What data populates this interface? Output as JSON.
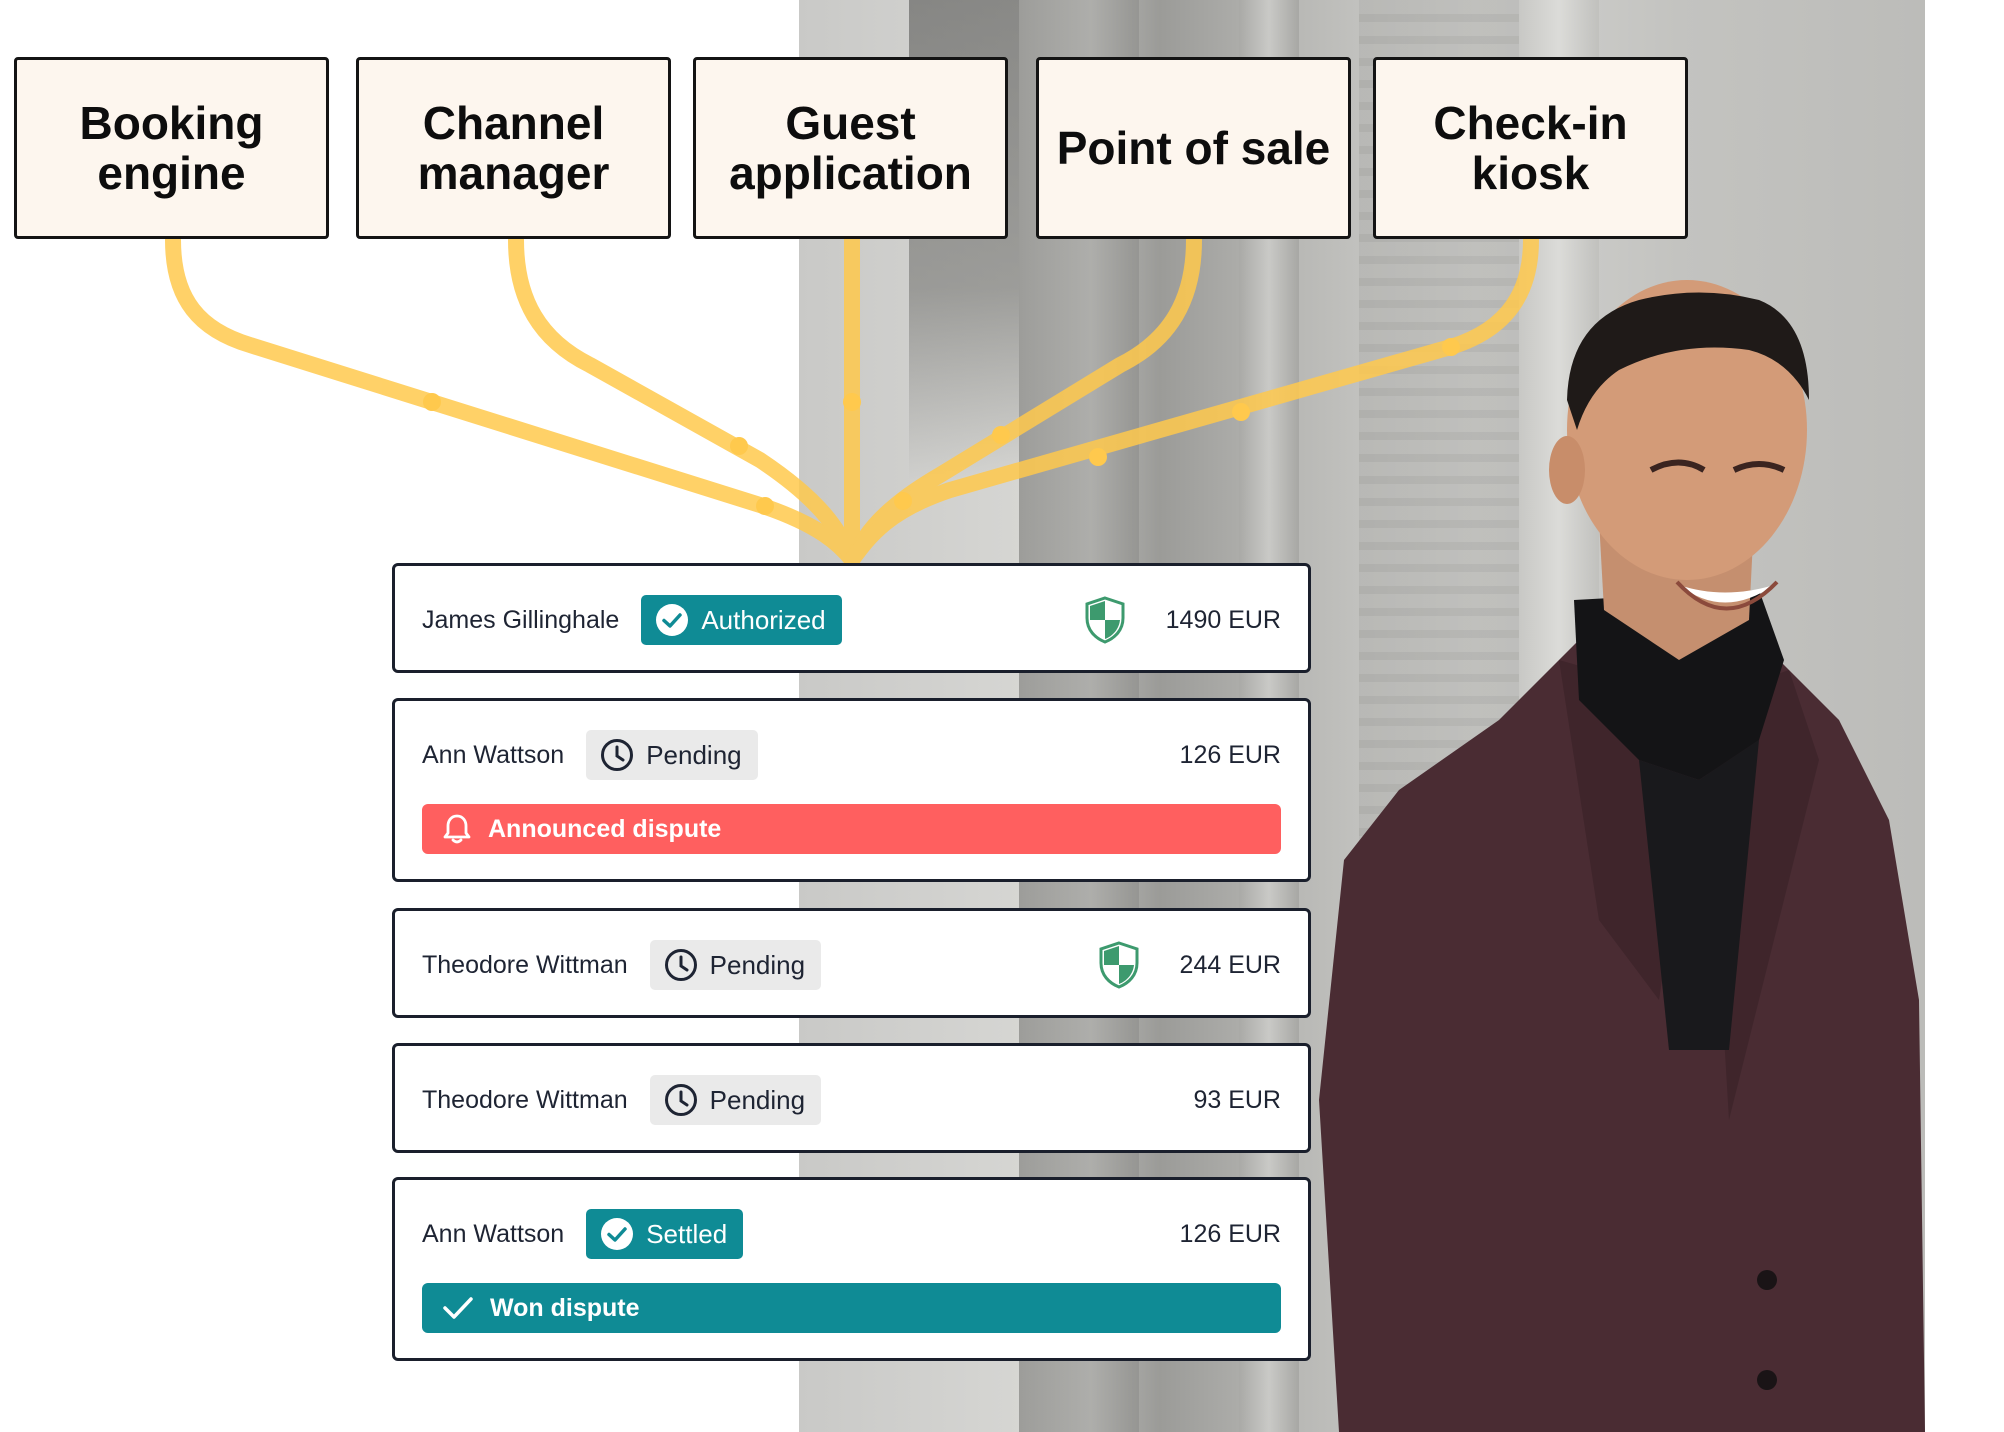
{
  "sources": [
    {
      "label": "Booking engine"
    },
    {
      "label": "Channel manager"
    },
    {
      "label": "Guest application"
    },
    {
      "label": "Point of sale"
    },
    {
      "label": "Check-in kiosk"
    }
  ],
  "transactions": [
    {
      "name": "James Gillinghale",
      "status": "Authorized",
      "status_style": "teal",
      "status_icon": "check-circle-icon",
      "shield": true,
      "amount": "1490 EUR"
    },
    {
      "name": "Ann Wattson",
      "status": "Pending",
      "status_style": "grey",
      "status_icon": "clock-icon",
      "shield": false,
      "amount": "126 EUR",
      "alert": {
        "label": "Announced dispute",
        "icon": "bell-icon",
        "style": "red"
      }
    },
    {
      "name": "Theodore Wittman",
      "status": "Pending",
      "status_style": "grey",
      "status_icon": "clock-icon",
      "shield": true,
      "amount": "244 EUR"
    },
    {
      "name": "Theodore Wittman",
      "status": "Pending",
      "status_style": "grey",
      "status_icon": "clock-icon",
      "shield": false,
      "amount": "93 EUR"
    },
    {
      "name": "Ann Wattson",
      "status": "Settled",
      "status_style": "teal",
      "status_icon": "check-circle-icon",
      "shield": false,
      "amount": "126 EUR",
      "alert": {
        "label": "Won dispute",
        "icon": "checkmark-icon",
        "style": "teal"
      }
    }
  ],
  "colors": {
    "connector": "#ffc94d",
    "box_fill": "#fdf6ee",
    "teal": "#0f8b95",
    "alert_red": "#ff5f5f",
    "shield_green": "#3d9a6e"
  }
}
